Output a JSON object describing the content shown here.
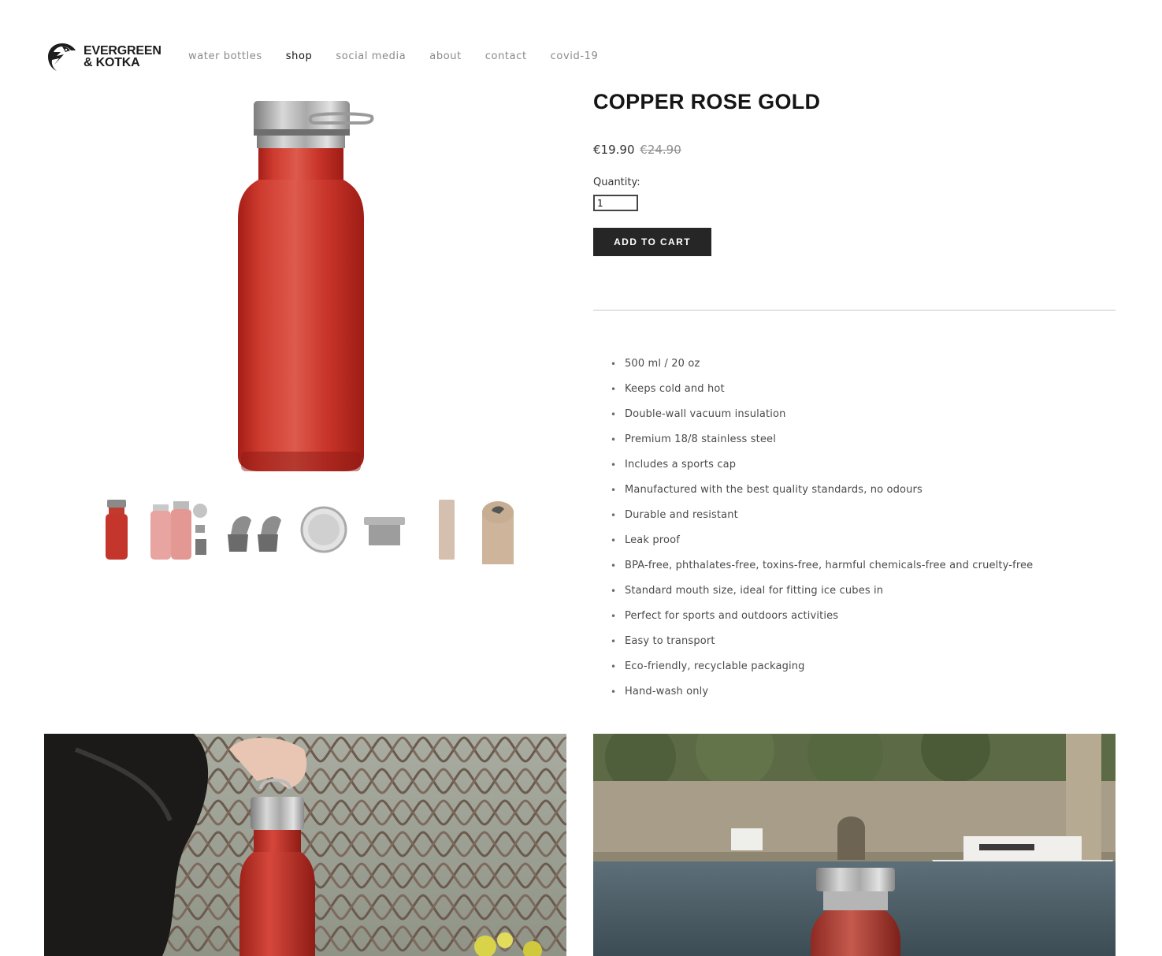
{
  "brand": {
    "name_line1": "EVERGREEN",
    "name_line2": "& KOTKA"
  },
  "nav": {
    "items": [
      {
        "label": "water bottles",
        "active": false
      },
      {
        "label": "shop",
        "active": true
      },
      {
        "label": "social media",
        "active": false
      },
      {
        "label": "about",
        "active": false
      },
      {
        "label": "contact",
        "active": false
      },
      {
        "label": "covid-19",
        "active": false
      }
    ]
  },
  "product": {
    "title": "COPPER ROSE GOLD",
    "price": "€19.90",
    "original_price": "€24.90",
    "quantity_label": "Quantity:",
    "quantity_value": "1",
    "add_to_cart_label": "ADD TO CART",
    "color": "#c4362c",
    "features": [
      "500 ml / 20 oz",
      "Keeps cold and hot",
      "Double-wall vacuum insulation",
      "Premium 18/8 stainless steel",
      "Includes a sports cap",
      "Manufactured with the best quality standards, no odours",
      "Durable and resistant",
      "Leak proof",
      "BPA-free, phthalates-free, toxins-free, harmful chemicals-free and cruelty-free",
      "Standard mouth size, ideal for fitting ice cubes in",
      "Perfect for sports and outdoors activities",
      "Easy to transport",
      "Eco-friendly, recyclable packaging",
      "Hand-wash only"
    ]
  },
  "gallery": {
    "thumbnails": [
      "red-bottle",
      "two-pink-bottles-with-caps",
      "sports-caps",
      "bottle-lid-top",
      "steel-cap",
      "packaging-tube",
      "packaging-tube-top"
    ]
  }
}
